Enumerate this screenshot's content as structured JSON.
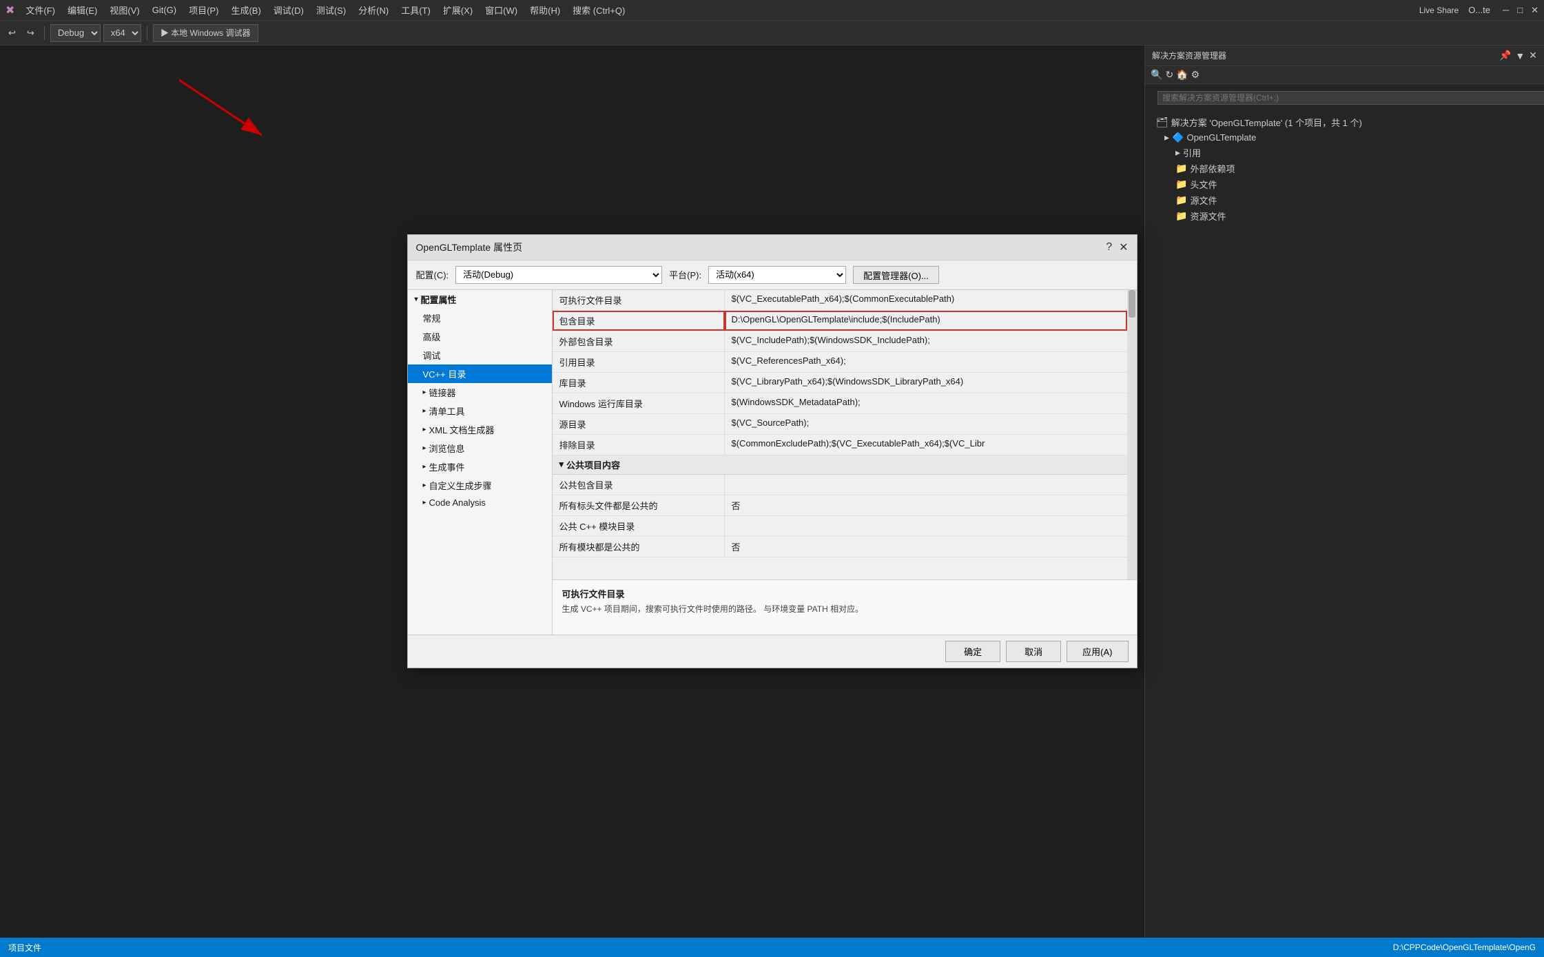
{
  "app": {
    "title": "O...te",
    "logo": "✕"
  },
  "menubar": {
    "items": [
      {
        "label": "文件(F)"
      },
      {
        "label": "编辑(E)"
      },
      {
        "label": "视图(V)"
      },
      {
        "label": "Git(G)"
      },
      {
        "label": "项目(P)"
      },
      {
        "label": "生成(B)"
      },
      {
        "label": "调试(D)"
      },
      {
        "label": "测试(S)"
      },
      {
        "label": "分析(N)"
      },
      {
        "label": "工具(T)"
      },
      {
        "label": "扩展(X)"
      },
      {
        "label": "窗口(W)"
      },
      {
        "label": "帮助(H)"
      },
      {
        "label": "搜索 (Ctrl+Q)"
      }
    ]
  },
  "toolbar": {
    "config_dropdown": "Debug",
    "arch_dropdown": "x64",
    "run_label": "▶ 本地 Windows 调试器",
    "live_share": "Live Share"
  },
  "solution_explorer": {
    "panel_title": "解决方案资源管理器",
    "search_placeholder": "搜索解决方案资源管理器(Ctrl+;)",
    "items": [
      {
        "label": "解决方案 'OpenGLTemplate' (1 个项目，共 1 个)",
        "level": 0,
        "icon": "🗂"
      },
      {
        "label": "OpenGLTemplate",
        "level": 1,
        "icon": "🔷"
      },
      {
        "label": "引用",
        "level": 2,
        "icon": "📁"
      },
      {
        "label": "外部依赖项",
        "level": 2,
        "icon": "📁"
      },
      {
        "label": "头文件",
        "level": 2,
        "icon": "📁"
      },
      {
        "label": "源文件",
        "level": 2,
        "icon": "📁"
      },
      {
        "label": "资源文件",
        "level": 2,
        "icon": "📁"
      }
    ]
  },
  "dialog": {
    "title": "OpenGLTemplate 属性页",
    "help_label": "?",
    "close_label": "✕",
    "config_label": "配置(C):",
    "config_value": "活动(Debug)",
    "platform_label": "平台(P):",
    "platform_value": "活动(x64)",
    "config_manager_btn": "配置管理器(O)...",
    "nav_items": [
      {
        "label": "▸ 配置属性",
        "level": 0,
        "active": false
      },
      {
        "label": "常规",
        "level": 1
      },
      {
        "label": "高级",
        "level": 1
      },
      {
        "label": "调试",
        "level": 1
      },
      {
        "label": "VC++ 目录",
        "level": 1,
        "active": true
      },
      {
        "label": "▸ 链接器",
        "level": 1
      },
      {
        "label": "▸ 清单工具",
        "level": 1
      },
      {
        "label": "▸ XML 文档生成器",
        "level": 1
      },
      {
        "label": "▸ 浏览信息",
        "level": 1
      },
      {
        "label": "▸ 生成事件",
        "level": 1
      },
      {
        "label": "▸ 自定义生成步骤",
        "level": 1
      },
      {
        "label": "▸ Code Analysis",
        "level": 1
      }
    ],
    "props": [
      {
        "key": "可执行文件目录",
        "val": "$(VC_ExecutablePath_x64);$(CommonExecutablePath)",
        "highlight_key": false,
        "highlight_val": false
      },
      {
        "key": "包含目录",
        "val": "D:\\OpenGL\\OpenGLTemplate\\include;$(IncludePath)",
        "highlight_key": true,
        "highlight_val": true
      },
      {
        "key": "外部包含目录",
        "val": "$(VC_IncludePath);$(WindowsSDK_IncludePath);",
        "highlight_key": false,
        "highlight_val": false
      },
      {
        "key": "引用目录",
        "val": "$(VC_ReferencesPath_x64);",
        "highlight_key": false,
        "highlight_val": false
      },
      {
        "key": "库目录",
        "val": "$(VC_LibraryPath_x64);$(WindowsSDK_LibraryPath_x64)",
        "highlight_key": false,
        "highlight_val": false
      },
      {
        "key": "Windows 运行库目录",
        "val": "$(WindowsSDK_MetadataPath);",
        "highlight_key": false,
        "highlight_val": false
      },
      {
        "key": "源目录",
        "val": "$(VC_SourcePath);",
        "highlight_key": false,
        "highlight_val": false
      },
      {
        "key": "排除目录",
        "val": "$(CommonExcludePath);$(VC_ExecutablePath_x64);$(VC_Libr",
        "highlight_key": false,
        "highlight_val": false
      }
    ],
    "public_section": "公共项目内容",
    "public_props": [
      {
        "key": "公共包含目录",
        "val": ""
      },
      {
        "key": "所有标头文件都是公共的",
        "val": "否"
      },
      {
        "key": "公共 C++ 模块目录",
        "val": ""
      },
      {
        "key": "所有模块都是公共的",
        "val": "否"
      }
    ],
    "desc_title": "可执行文件目录",
    "desc_text": "生成 VC++ 项目期间，搜索可执行文件时使用的路径。 与环境变量 PATH 相对应。",
    "footer": {
      "ok": "确定",
      "cancel": "取消",
      "apply": "应用(A)"
    }
  },
  "status_bar": {
    "left": "项目文件",
    "right": "D:\\CPPCode\\OpenGLTemplate\\OpenG"
  }
}
